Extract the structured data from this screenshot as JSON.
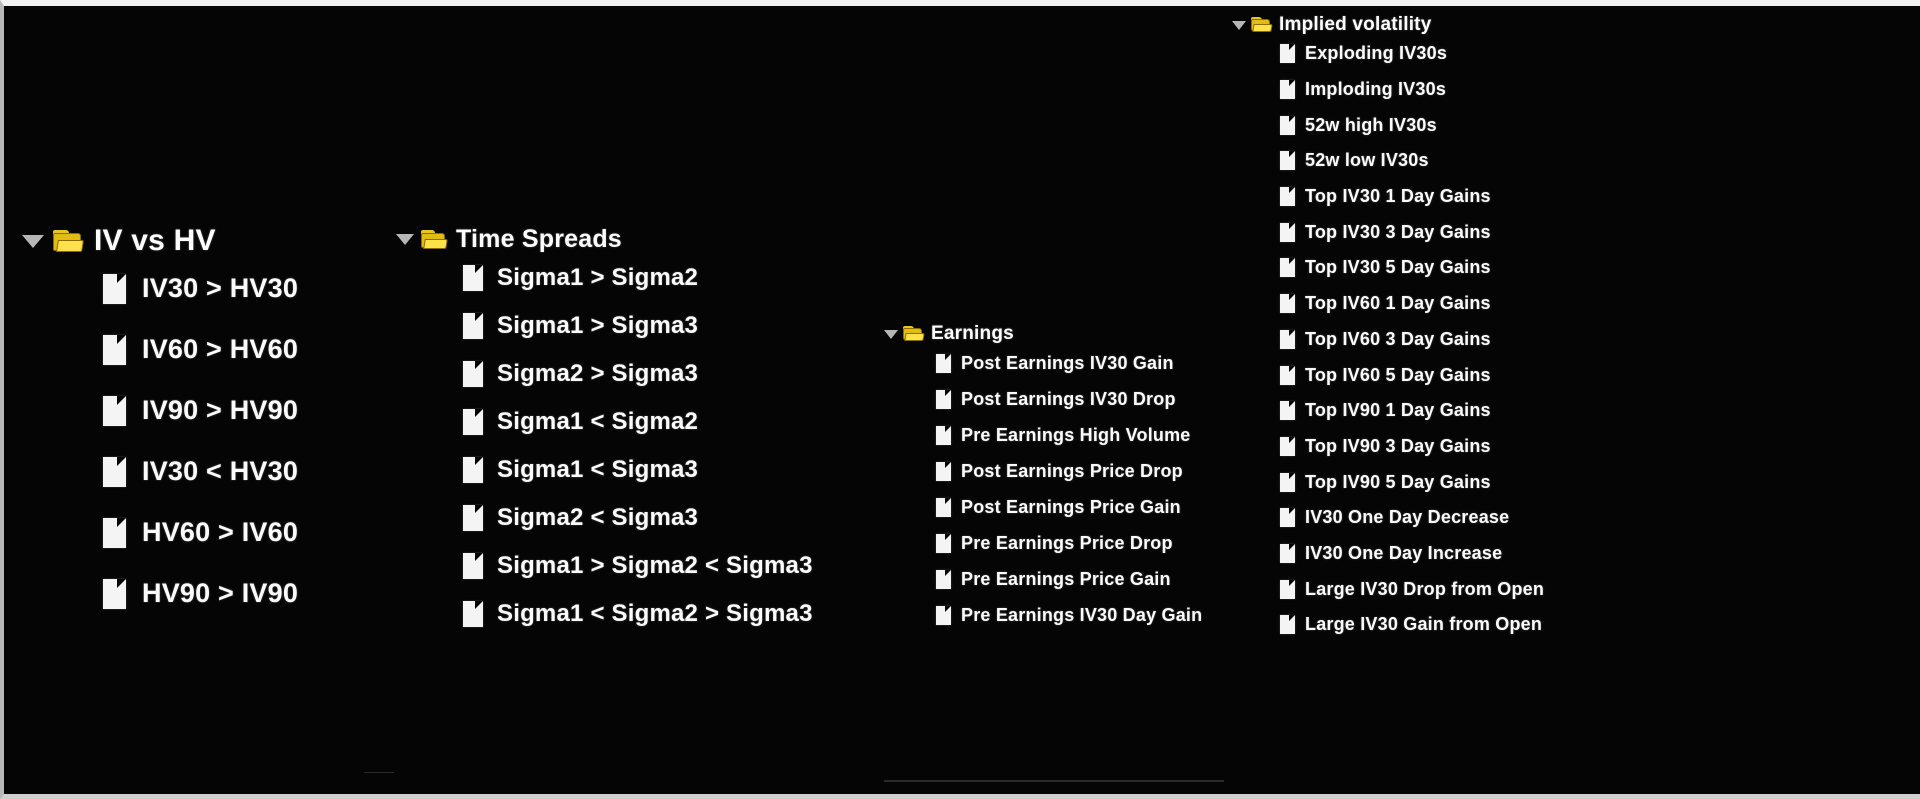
{
  "theme": {
    "background": "#050505",
    "text_color": "#fbfbfb",
    "folder_color": "#e2bc12",
    "file_color": "#f4f4f4",
    "disclosure_color": "#b6b6b6"
  },
  "icons": {
    "disclosure": "triangle-down-icon",
    "folder": "open-folder-icon",
    "file": "document-icon"
  },
  "columns": [
    {
      "id": "iv-vs-hv",
      "label": "IV vs HV",
      "expanded": true,
      "items": [
        {
          "label": "IV30 > HV30"
        },
        {
          "label": "IV60 > HV60"
        },
        {
          "label": "IV90 > HV90"
        },
        {
          "label": "IV30 < HV30"
        },
        {
          "label": "HV60 > IV60"
        },
        {
          "label": "HV90 > IV90"
        }
      ]
    },
    {
      "id": "time-spreads",
      "label": "Time Spreads",
      "expanded": true,
      "items": [
        {
          "label": "Sigma1 > Sigma2"
        },
        {
          "label": "Sigma1 > Sigma3"
        },
        {
          "label": "Sigma2 > Sigma3"
        },
        {
          "label": "Sigma1 < Sigma2"
        },
        {
          "label": "Sigma1 < Sigma3"
        },
        {
          "label": "Sigma2 < Sigma3"
        },
        {
          "label": "Sigma1 > Sigma2 < Sigma3"
        },
        {
          "label": "Sigma1 < Sigma2 > Sigma3"
        }
      ]
    },
    {
      "id": "earnings",
      "label": "Earnings",
      "expanded": true,
      "items": [
        {
          "label": "Post Earnings IV30 Gain"
        },
        {
          "label": "Post Earnings IV30 Drop"
        },
        {
          "label": "Pre Earnings High Volume"
        },
        {
          "label": "Post Earnings Price Drop"
        },
        {
          "label": "Post Earnings Price Gain"
        },
        {
          "label": "Pre Earnings Price Drop"
        },
        {
          "label": "Pre Earnings Price Gain"
        },
        {
          "label": "Pre Earnings IV30 Day Gain"
        }
      ]
    },
    {
      "id": "implied-volatility",
      "label": "Implied volatility",
      "expanded": true,
      "items": [
        {
          "label": "Exploding IV30s"
        },
        {
          "label": "Imploding IV30s"
        },
        {
          "label": "52w high IV30s"
        },
        {
          "label": "52w low IV30s"
        },
        {
          "label": "Top IV30 1 Day Gains"
        },
        {
          "label": "Top IV30 3 Day Gains"
        },
        {
          "label": "Top IV30 5 Day Gains"
        },
        {
          "label": "Top IV60 1 Day Gains"
        },
        {
          "label": "Top IV60 3 Day Gains"
        },
        {
          "label": "Top IV60 5 Day Gains"
        },
        {
          "label": "Top IV90 1 Day Gains"
        },
        {
          "label": "Top IV90 3 Day Gains"
        },
        {
          "label": "Top IV90 5 Day Gains"
        },
        {
          "label": "IV30 One Day Decrease"
        },
        {
          "label": "IV30 One Day Increase"
        },
        {
          "label": "Large IV30 Drop from Open"
        },
        {
          "label": "Large IV30 Gain from Open"
        }
      ]
    }
  ]
}
